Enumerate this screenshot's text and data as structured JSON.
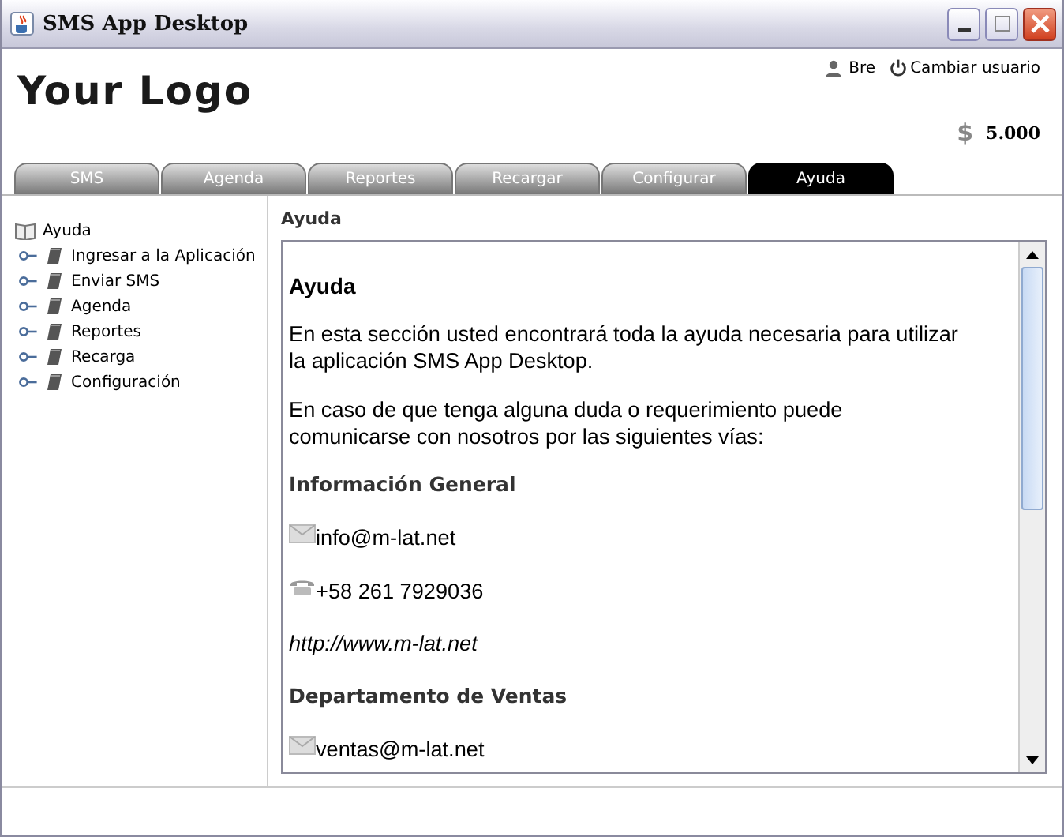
{
  "window": {
    "title": "SMS App Desktop"
  },
  "header": {
    "logo": "Your Logo",
    "user": "Bre",
    "switch_user": "Cambiar usuario",
    "currency": "$",
    "balance": "5.000"
  },
  "tabs": [
    {
      "label": "SMS",
      "selected": false
    },
    {
      "label": "Agenda",
      "selected": false
    },
    {
      "label": "Reportes",
      "selected": false
    },
    {
      "label": "Recargar",
      "selected": false
    },
    {
      "label": "Configurar",
      "selected": false
    },
    {
      "label": "Ayuda",
      "selected": true
    }
  ],
  "tree": {
    "label": "Ayuda",
    "children": [
      {
        "label": "Ingresar a la Aplicación"
      },
      {
        "label": "Enviar SMS"
      },
      {
        "label": "Agenda"
      },
      {
        "label": "Reportes"
      },
      {
        "label": "Recarga"
      },
      {
        "label": "Configuración"
      }
    ]
  },
  "content": {
    "title": "Ayuda",
    "blocks": [
      {
        "kind": "heading",
        "text": "Ayuda"
      },
      {
        "kind": "paragraph",
        "text": "En esta sección usted encontrará toda la ayuda necesaria para utilizar la aplicación SMS App Desktop."
      },
      {
        "kind": "paragraph",
        "text": "En caso de que tenga alguna duda o requerimiento puede comunicarse con nosotros por las siguientes vías:"
      },
      {
        "kind": "subheading",
        "text": "Información General"
      },
      {
        "kind": "email",
        "text": "info@m-lat.net"
      },
      {
        "kind": "phone",
        "text": "+58 261 7929036"
      },
      {
        "kind": "link",
        "text": "http://www.m-lat.net"
      },
      {
        "kind": "subheading",
        "text": "Departamento de Ventas"
      },
      {
        "kind": "email",
        "text": "ventas@m-lat.net"
      }
    ]
  }
}
